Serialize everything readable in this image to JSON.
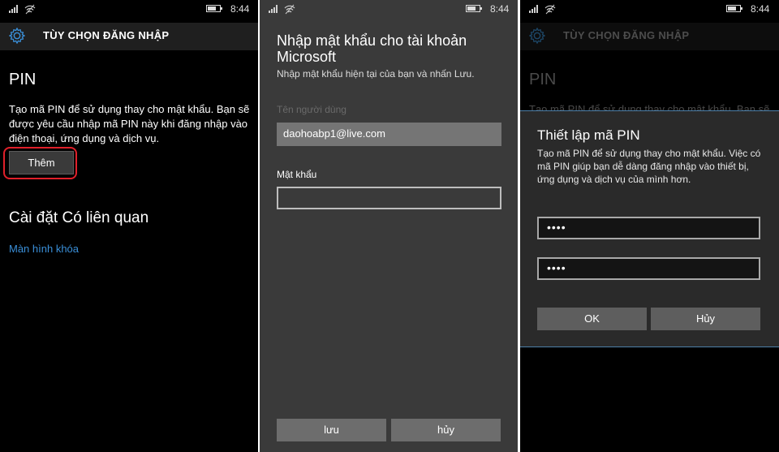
{
  "screen1": {
    "status_time": "8:44",
    "header_title": "TÙY CHỌN ĐĂNG NHẬP",
    "pin_heading": "PIN",
    "pin_description": "Tạo mã PIN để sử dụng thay cho mật khẩu. Bạn sẽ được yêu cầu nhập mã PIN này khi đăng nhập vào điện thoại, ứng dụng và dịch vụ.",
    "add_button": "Thêm",
    "related_heading": "Cài đặt Có liên quan",
    "lock_screen_link": "Màn hình khóa"
  },
  "screen2": {
    "status_time": "8:44",
    "title": "Nhập mật khẩu cho tài khoản Microsoft",
    "subtitle": "Nhập mật khẩu hiện tại của bạn và nhấn Lưu.",
    "username_label": "Tên người dùng",
    "username_value": "daohoabp1@live.com",
    "password_label": "Mật khẩu",
    "password_value": "",
    "save_button": "lưu",
    "cancel_button": "hủy"
  },
  "screen3": {
    "status_time": "8:44",
    "header_title": "TÙY CHỌN ĐĂNG NHẬP",
    "pin_heading": "PIN",
    "pin_description": "Tạo mã PIN để sử dụng thay cho mật khẩu. Bạn sẽ",
    "dialog": {
      "title": "Thiết lập mã PIN",
      "description": "Tạo mã PIN để sử dụng thay cho mật khẩu. Việc có mã PIN giúp bạn dễ dàng đăng nhập vào thiết bị, ứng dụng và dịch vụ của mình hơn.",
      "pin_value": "••••",
      "confirm_pin_value": "••••",
      "ok_button": "OK",
      "cancel_button": "Hủy"
    }
  },
  "colors": {
    "accent_link": "#3a8fd8",
    "highlight_outline": "#e0202a",
    "dialog_border": "#4d7fa8"
  },
  "icons": [
    "signal-icon",
    "wifi-icon",
    "battery-icon",
    "gear-icon"
  ]
}
